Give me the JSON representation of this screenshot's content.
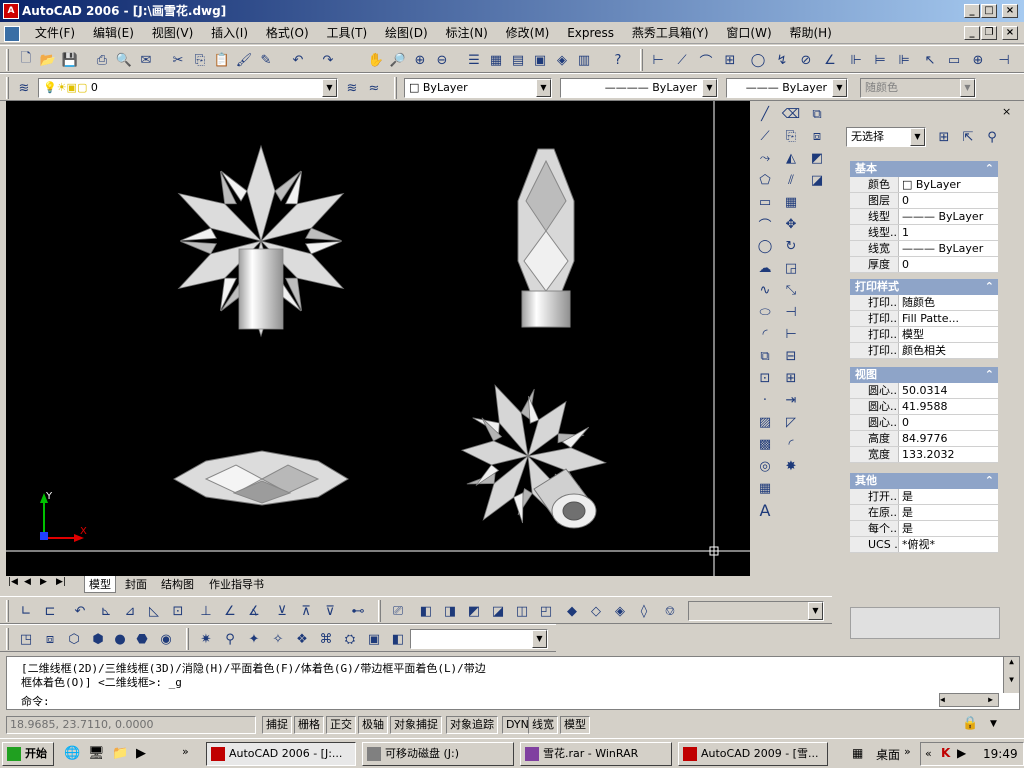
{
  "window": {
    "title": "AutoCAD 2006 - [J:\\画雪花.dwg]"
  },
  "menu": [
    "文件(F)",
    "编辑(E)",
    "视图(V)",
    "插入(I)",
    "格式(O)",
    "工具(T)",
    "绘图(D)",
    "标注(N)",
    "修改(M)",
    "Express",
    "燕秀工具箱(Y)",
    "窗口(W)",
    "帮助(H)"
  ],
  "layers": {
    "current": "0",
    "color": "ByLayer",
    "linetype": "ByLayer",
    "lineweight": "ByLayer",
    "plotstyle": "随颜色"
  },
  "layout_tabs": [
    "模型",
    "封面",
    "结构图",
    "作业指导书"
  ],
  "properties": {
    "selection": "无选择",
    "sections": [
      {
        "title": "基本",
        "rows": [
          [
            "颜色",
            "□ ByLayer"
          ],
          [
            "图层",
            "0"
          ],
          [
            "线型",
            "——— ByLayer"
          ],
          [
            "线型...",
            "1"
          ],
          [
            "线宽",
            "——— ByLayer"
          ],
          [
            "厚度",
            "0"
          ]
        ]
      },
      {
        "title": "打印样式",
        "rows": [
          [
            "打印...",
            "随颜色"
          ],
          [
            "打印...",
            "Fill Patte..."
          ],
          [
            "打印...",
            "模型"
          ],
          [
            "打印...",
            "颜色相关"
          ]
        ]
      },
      {
        "title": "视图",
        "rows": [
          [
            "圆心...",
            "50.0314"
          ],
          [
            "圆心...",
            "41.9588"
          ],
          [
            "圆心...",
            "0"
          ],
          [
            "高度",
            "84.9776"
          ],
          [
            "宽度",
            "133.2032"
          ]
        ]
      },
      {
        "title": "其他",
        "rows": [
          [
            "打开...",
            "是"
          ],
          [
            "在原...",
            "是"
          ],
          [
            "每个...",
            "是"
          ],
          [
            "UCS ...",
            "*俯视*"
          ]
        ]
      }
    ]
  },
  "command": {
    "line1": "[二维线框(2D)/三维线框(3D)/消隐(H)/平面着色(F)/体着色(G)/带边框平面着色(L)/带边",
    "line2": "框体着色(O)] <二维线框>: _g",
    "prompt": "命令:"
  },
  "status": {
    "coords": "18.9685, 23.7110, 0.0000",
    "toggles": [
      "捕捉",
      "栅格",
      "正交",
      "极轴",
      "对象捕捉",
      "对象追踪",
      "DYN",
      "线宽",
      "模型"
    ]
  },
  "taskbar": {
    "start": "开始",
    "tasks": [
      "AutoCAD 2006 - [J:...",
      "可移动磁盘 (J:)",
      "雪花.rar - WinRAR",
      "AutoCAD 2009 - [雪..."
    ],
    "desktop": "桌面",
    "clock": "19:49"
  },
  "axis": {
    "x": "X",
    "y": "Y"
  }
}
